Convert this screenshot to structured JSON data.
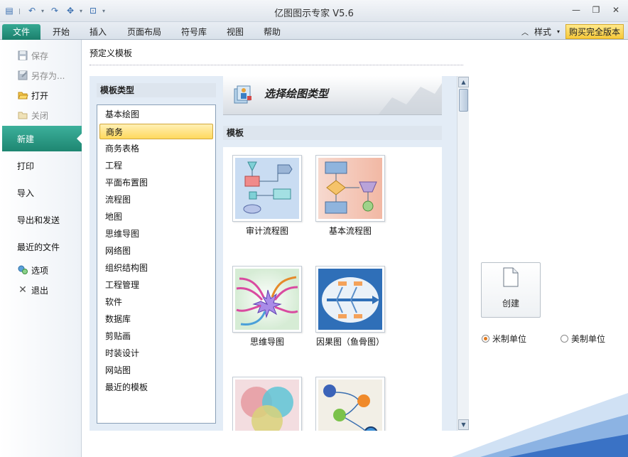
{
  "window": {
    "title": "亿图图示专家 V5.6"
  },
  "quick_access": {
    "icons": [
      "app-menu-icon",
      "undo-icon",
      "redo-icon",
      "move-icon",
      "preview-icon",
      "customize-icon"
    ]
  },
  "ribbon": {
    "tabs": [
      "文件",
      "开始",
      "插入",
      "页面布局",
      "符号库",
      "视图",
      "帮助"
    ],
    "style_label": "样式",
    "buy_label": "购买完全版本"
  },
  "nav": {
    "items": [
      {
        "label": "保存",
        "disabled": true,
        "icon": "save-icon"
      },
      {
        "label": "另存为...",
        "disabled": true,
        "icon": "save-as-icon"
      },
      {
        "label": "打开",
        "disabled": false,
        "icon": "open-folder-icon"
      },
      {
        "label": "关闭",
        "disabled": true,
        "icon": "close-folder-icon"
      },
      {
        "label": "新建",
        "active": true
      },
      {
        "label": "打印"
      },
      {
        "label": "导入"
      },
      {
        "label": "导出和发送"
      },
      {
        "label": "最近的文件"
      },
      {
        "label": "选项",
        "icon": "options-icon"
      },
      {
        "label": "退出",
        "icon": "exit-icon"
      }
    ]
  },
  "main": {
    "section_title": "预定义模板",
    "category_header": "模板类型",
    "categories": [
      "基本绘图",
      "商务",
      "商务表格",
      "工程",
      "平面布置图",
      "流程图",
      "地图",
      "思维导图",
      "网络图",
      "组织结构图",
      "工程管理",
      "软件",
      "数据库",
      "剪贴画",
      "时装设计",
      "网站图",
      "最近的模板"
    ],
    "selected_category": "商务",
    "banner_title": "选择绘图类型",
    "templates_header": "模板",
    "templates": [
      "审计流程图",
      "基本流程图",
      "思维导图",
      "因果图（鱼骨图）",
      "",
      ""
    ],
    "create_label": "创建",
    "units": {
      "metric": "米制单位",
      "us": "美制单位",
      "selected": "metric"
    }
  },
  "colors": {
    "accent": "#1e8671",
    "selection": "#ffd95d",
    "buy_button": "#f7c93a"
  }
}
